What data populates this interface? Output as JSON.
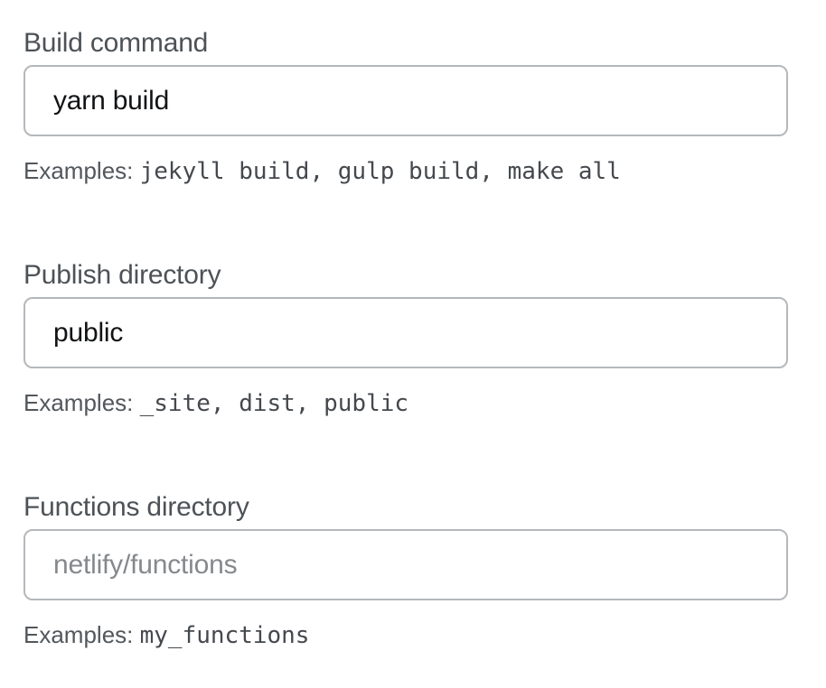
{
  "fields": [
    {
      "label": "Build command",
      "value": "yarn build",
      "placeholder": "",
      "help_prefix": "Examples:",
      "help_examples": "jekyll build, gulp build, make all"
    },
    {
      "label": "Publish directory",
      "value": "public",
      "placeholder": "",
      "help_prefix": "Examples:",
      "help_examples": "_site, dist, public"
    },
    {
      "label": "Functions directory",
      "value": "",
      "placeholder": "netlify/functions",
      "help_prefix": "Examples:",
      "help_examples": "my_functions"
    }
  ]
}
